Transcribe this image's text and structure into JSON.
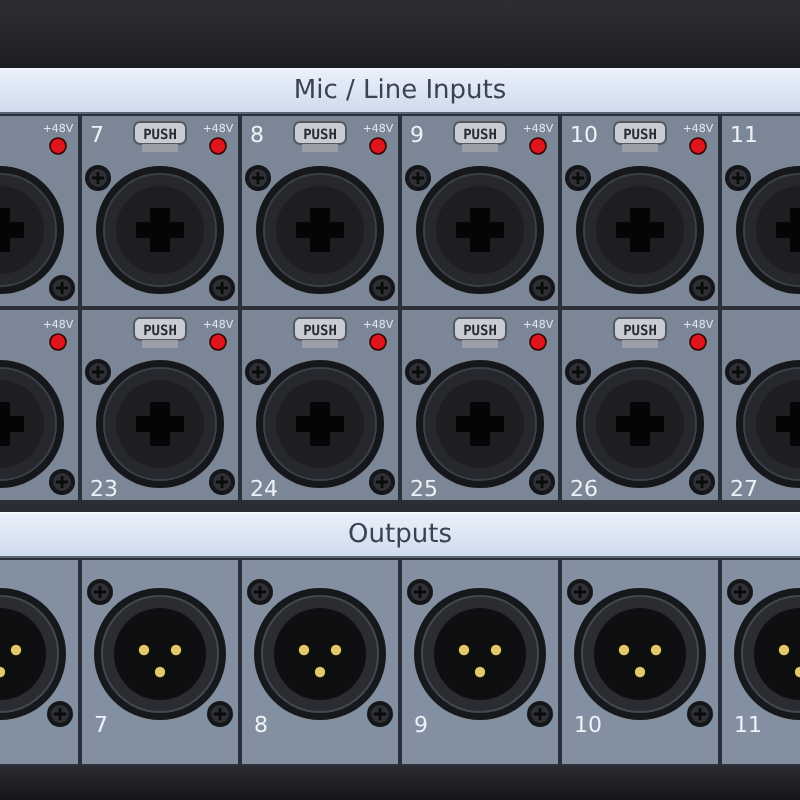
{
  "inputs": {
    "title": "Mic / Line Inputs",
    "rows": [
      {
        "cells": [
          {
            "phantom_label": "+48V",
            "led_lit": true
          },
          {
            "number": "7",
            "latch": "PUSH",
            "phantom_label": "+48V",
            "led_lit": true
          },
          {
            "number": "8",
            "latch": "PUSH",
            "phantom_label": "+48V",
            "led_lit": true
          },
          {
            "number": "9",
            "latch": "PUSH",
            "phantom_label": "+48V",
            "led_lit": true
          },
          {
            "number": "10",
            "latch": "PUSH",
            "phantom_label": "+48V",
            "led_lit": true
          },
          {
            "number": "11"
          }
        ]
      },
      {
        "cells": [
          {
            "phantom_label": "+48V",
            "led_lit": true
          },
          {
            "number": "23",
            "latch": "PUSH",
            "phantom_label": "+48V",
            "led_lit": true
          },
          {
            "number": "24",
            "latch": "PUSH",
            "phantom_label": "+48V",
            "led_lit": true
          },
          {
            "number": "25",
            "latch": "PUSH",
            "phantom_label": "+48V",
            "led_lit": true
          },
          {
            "number": "26",
            "latch": "PUSH",
            "phantom_label": "+48V",
            "led_lit": true
          },
          {
            "number": "27"
          }
        ]
      }
    ]
  },
  "outputs": {
    "title": "Outputs",
    "cells": [
      {},
      {
        "number": "7"
      },
      {
        "number": "8"
      },
      {
        "number": "9"
      },
      {
        "number": "10"
      },
      {
        "number": "11"
      }
    ]
  }
}
